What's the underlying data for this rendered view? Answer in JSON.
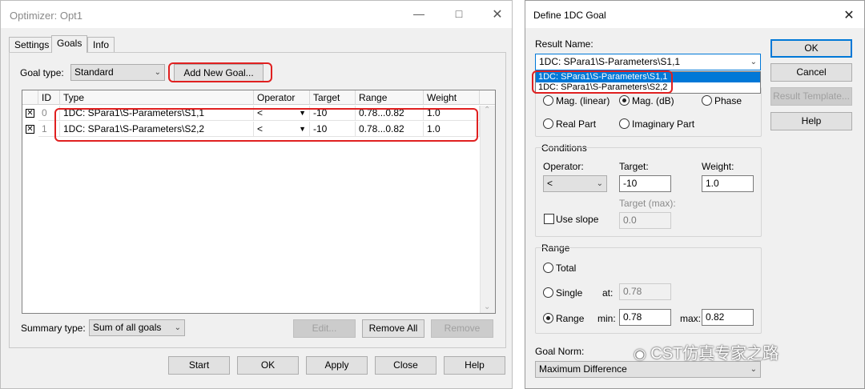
{
  "optimizer": {
    "title": "Optimizer: Opt1",
    "tabs": [
      "Settings",
      "Goals",
      "Info"
    ],
    "goal_type_label": "Goal type:",
    "goal_type_value": "Standard",
    "add_goal_button": "Add New Goal...",
    "columns": [
      "ID",
      "Type",
      "Operator",
      "Target",
      "Range",
      "Weight"
    ],
    "rows": [
      {
        "id": "0",
        "type": "1DC: SPara1\\S-Parameters\\S1,1",
        "operator": "<",
        "target": "-10",
        "range": "0.78...0.82",
        "weight": "1.0"
      },
      {
        "id": "1",
        "type": "1DC: SPara1\\S-Parameters\\S2,2",
        "operator": "<",
        "target": "-10",
        "range": "0.78...0.82",
        "weight": "1.0"
      }
    ],
    "summary_label": "Summary type:",
    "summary_value": "Sum of all goals",
    "edit_button": "Edit...",
    "remove_all_button": "Remove All",
    "remove_button": "Remove",
    "start_button": "Start",
    "ok_button": "OK",
    "apply_button": "Apply",
    "close_button": "Close",
    "help_button": "Help"
  },
  "define_goal": {
    "title": "Define 1DC Goal",
    "result_name_label": "Result Name:",
    "result_selected": "1DC: SPara1\\S-Parameters\\S1,1",
    "dropdown_options": [
      "1DC: SPara1\\S-Parameters\\S1,1",
      "1DC: SPara1\\S-Parameters\\S2,2"
    ],
    "radio_mag_linear": "Mag. (linear)",
    "radio_mag_db": "Mag. (dB)",
    "radio_phase": "Phase",
    "radio_real": "Real Part",
    "radio_imag": "Imaginary Part",
    "conditions_label": "Conditions",
    "operator_label": "Operator:",
    "operator_value": "<",
    "target_label": "Target:",
    "target_value": "-10",
    "weight_label": "Weight:",
    "weight_value": "1.0",
    "target_max_label": "Target (max):",
    "target_max_value": "0.0",
    "use_slope_label": "Use slope",
    "range_label": "Range",
    "radio_total": "Total",
    "radio_single": "Single",
    "at_label": "at:",
    "at_value": "0.78",
    "radio_range": "Range",
    "min_label": "min:",
    "min_value": "0.78",
    "max_label": "max:",
    "max_value": "0.82",
    "goal_norm_label": "Goal Norm:",
    "goal_norm_value": "Maximum Difference",
    "ok_button": "OK",
    "cancel_button": "Cancel",
    "result_template_button": "Result Template...",
    "help_button": "Help"
  },
  "watermark": "CST仿真专家之路"
}
